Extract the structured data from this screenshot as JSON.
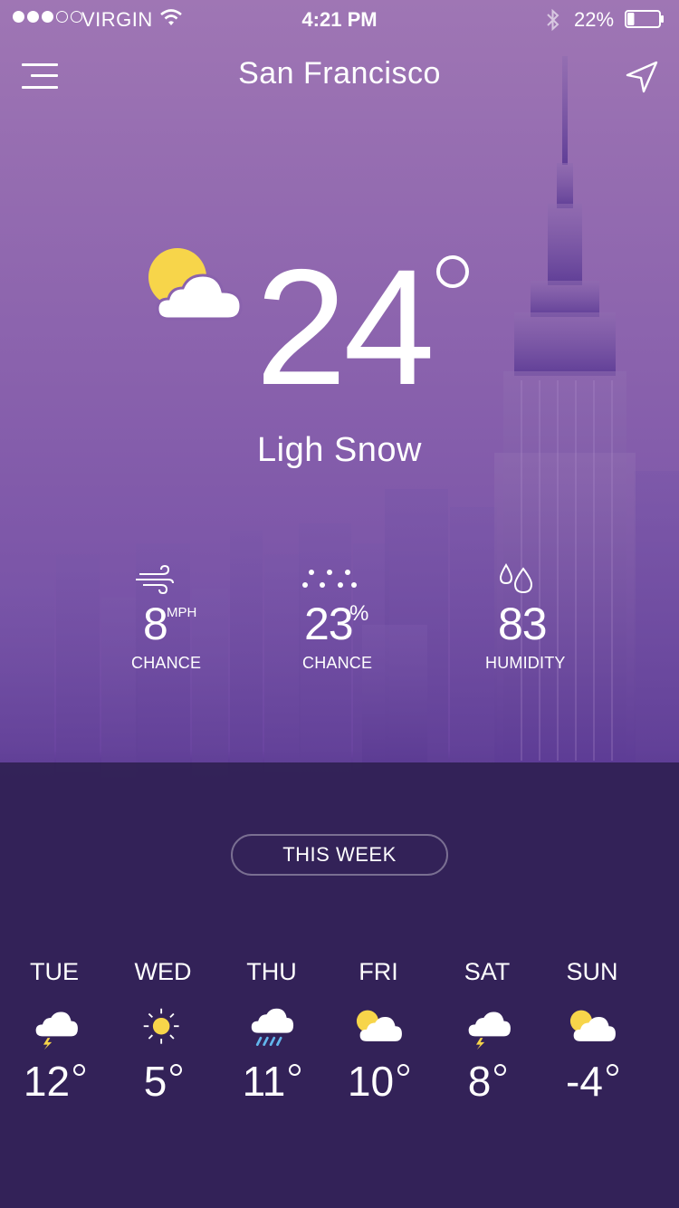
{
  "status": {
    "carrier": "VIRGIN",
    "time": "4:21 PM",
    "battery": "22%",
    "battery_level": 0.22
  },
  "header": {
    "city": "San Francisco"
  },
  "current": {
    "temperature": "24",
    "condition": "Ligh Snow",
    "icon": "partly-cloudy-icon"
  },
  "stats": [
    {
      "icon": "wind-icon",
      "value": "8",
      "unit": "MPH",
      "label": "CHANCE"
    },
    {
      "icon": "precipitation-icon",
      "value": "23",
      "unit": "%",
      "label": "CHANCE"
    },
    {
      "icon": "humidity-icon",
      "value": "83",
      "unit": "",
      "label": "HUMIDITY"
    }
  ],
  "week": {
    "label": "THIS WEEK",
    "days": [
      {
        "day": "TUE",
        "temp": "12",
        "icon": "thunderstorm-icon"
      },
      {
        "day": "WED",
        "temp": "5",
        "icon": "sun-icon"
      },
      {
        "day": "THU",
        "temp": "11",
        "icon": "rain-icon"
      },
      {
        "day": "FRI",
        "temp": "10",
        "icon": "partly-cloudy-icon"
      },
      {
        "day": "SAT",
        "temp": "8",
        "icon": "thunderstorm-icon"
      },
      {
        "day": "SUN",
        "temp": "-4",
        "icon": "partly-cloudy-icon"
      }
    ]
  },
  "colors": {
    "sun": "#f7d54a",
    "rain": "#62b6ec",
    "bolt": "#f7d54a",
    "panel": "#2c1e4e"
  }
}
